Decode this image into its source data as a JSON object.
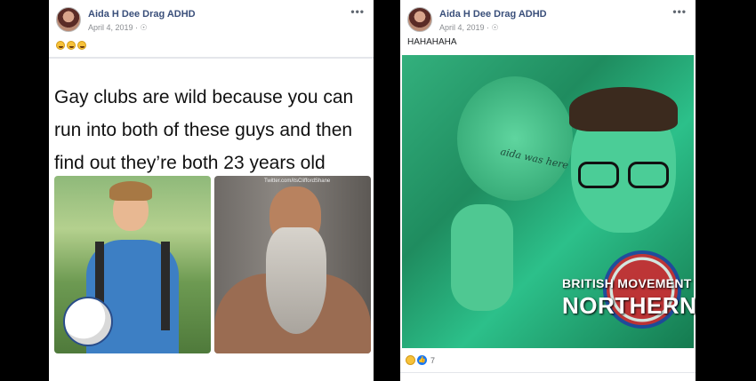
{
  "left_post": {
    "author": "Aida H Dee Drag ADHD",
    "timestamp": "April 4, 2019 · ☉",
    "more": "•••",
    "reactions_icons": [
      "laughing-emoji",
      "laughing-emoji",
      "laughing-emoji"
    ],
    "meme_text": "Gay clubs are wild because you can run into both of these guys and then find out they’re both 23 years old",
    "image_watermark": "Twitter.com/itsCliffordShane"
  },
  "right_post": {
    "author": "Aida H Dee Drag ADHD",
    "timestamp": "April 4, 2019 · ☉",
    "more": "•••",
    "text": "HAHAHAHA",
    "photo_writing": "aida was here",
    "reaction_count": "7"
  },
  "overlay_logo": {
    "line1": "BRITISH MOVEMENT",
    "line2": "NORTHERN"
  }
}
